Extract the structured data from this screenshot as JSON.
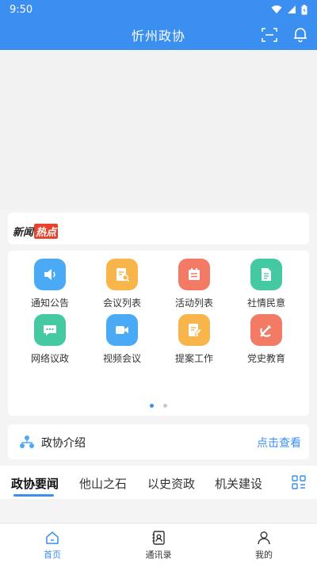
{
  "status_bar": {
    "time": "9:50"
  },
  "header": {
    "title": "忻州政协"
  },
  "news_card": {
    "logo_part1": "新闻",
    "logo_part2": "热点"
  },
  "grid": {
    "items": [
      {
        "label": "通知公告",
        "icon": "speaker-icon",
        "color": "#4aaaf5"
      },
      {
        "label": "会议列表",
        "icon": "meeting-list-icon",
        "color": "#f7b54a"
      },
      {
        "label": "活动列表",
        "icon": "activity-calendar-icon",
        "color": "#f37a64"
      },
      {
        "label": "社情民意",
        "icon": "document-icon",
        "color": "#45c9a3"
      },
      {
        "label": "网络议政",
        "icon": "chat-icon",
        "color": "#45c9a3"
      },
      {
        "label": "视频会议",
        "icon": "video-icon",
        "color": "#4aaaf5"
      },
      {
        "label": "提案工作",
        "icon": "edit-document-icon",
        "color": "#f7b54a"
      },
      {
        "label": "党史教育",
        "icon": "party-emblem-icon",
        "color": "#f37a64"
      }
    ],
    "page_indicator": {
      "pages": 2,
      "current": 1
    }
  },
  "intro": {
    "title": "政协介绍",
    "link": "点击查看"
  },
  "tabs": [
    "政协要闻",
    "他山之石",
    "以史资政",
    "机关建设"
  ],
  "bottom_nav": [
    {
      "label": "首页",
      "icon": "home-icon",
      "active": true
    },
    {
      "label": "通讯录",
      "icon": "contacts-icon",
      "active": false
    },
    {
      "label": "我的",
      "icon": "profile-icon",
      "active": false
    }
  ],
  "colors": {
    "primary": "#3a8ff0"
  }
}
